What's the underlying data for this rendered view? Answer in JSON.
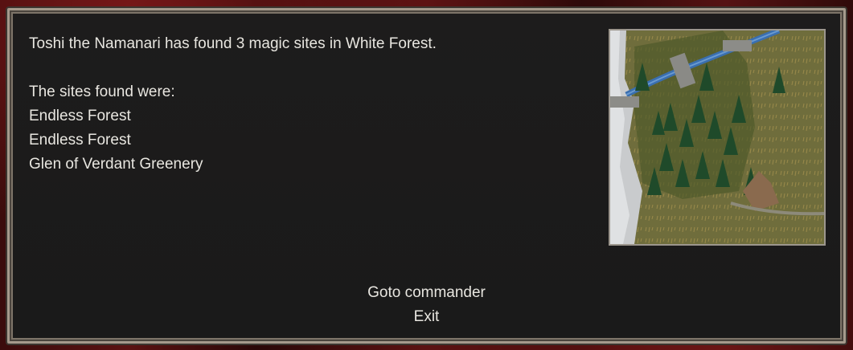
{
  "message": {
    "line1": "Toshi the Namanari has found 3 magic sites in White Forest.",
    "line2": "The sites found were:",
    "sites": [
      "Endless Forest",
      "Endless Forest",
      "Glen of Verdant Greenery"
    ]
  },
  "actions": {
    "goto": "Goto commander",
    "exit": "Exit"
  },
  "colors": {
    "text": "#e8e6e0",
    "panel": "#1b1b1b",
    "border": "#a59a8c",
    "background": "#4a0f0f"
  }
}
